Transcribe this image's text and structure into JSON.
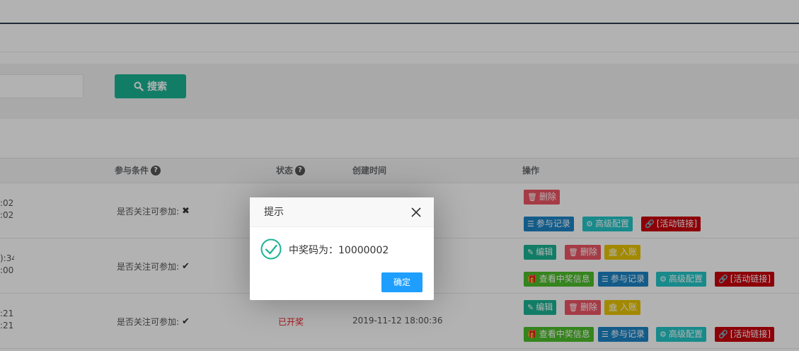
{
  "search": {
    "button_label": "搜索",
    "input_value": ""
  },
  "table": {
    "headers": {
      "condition": "参与条件",
      "status": "状态",
      "created": "创建时间",
      "actions": "操作"
    },
    "rows": [
      {
        "time_start": ":02~",
        "time_end": ":02",
        "condition": "是否关注可参加:",
        "condition_mark": "✖",
        "status": "",
        "created": "",
        "actions": [
          "删除",
          "参与记录",
          "高级配置",
          "[活动链接]"
        ]
      },
      {
        "time_start": "):34~",
        "time_end": ":00",
        "condition": "是否关注可参加:",
        "condition_mark": "✔",
        "status": "",
        "created": "",
        "actions": [
          "编辑",
          "删除",
          "入账",
          "查看中奖信息",
          "参与记录",
          "高级配置",
          "[活动链接]"
        ]
      },
      {
        "time_start": ":21~",
        "time_end": ":21",
        "condition": "是否关注可参加:",
        "condition_mark": "✔",
        "status": "已开奖",
        "created": "2019-11-12 18:00:36",
        "actions": [
          "编辑",
          "删除",
          "入账",
          "查看中奖信息",
          "参与记录",
          "高级配置",
          "[活动链接]"
        ]
      }
    ]
  },
  "dialog": {
    "title": "提示",
    "message": "中奖码为：10000002",
    "confirm_label": "确定"
  },
  "colors": {
    "primary_green": "#1ab394",
    "danger_red": "#ed5565",
    "info_blue": "#1c84c6",
    "dialog_button": "#1e9fff"
  }
}
